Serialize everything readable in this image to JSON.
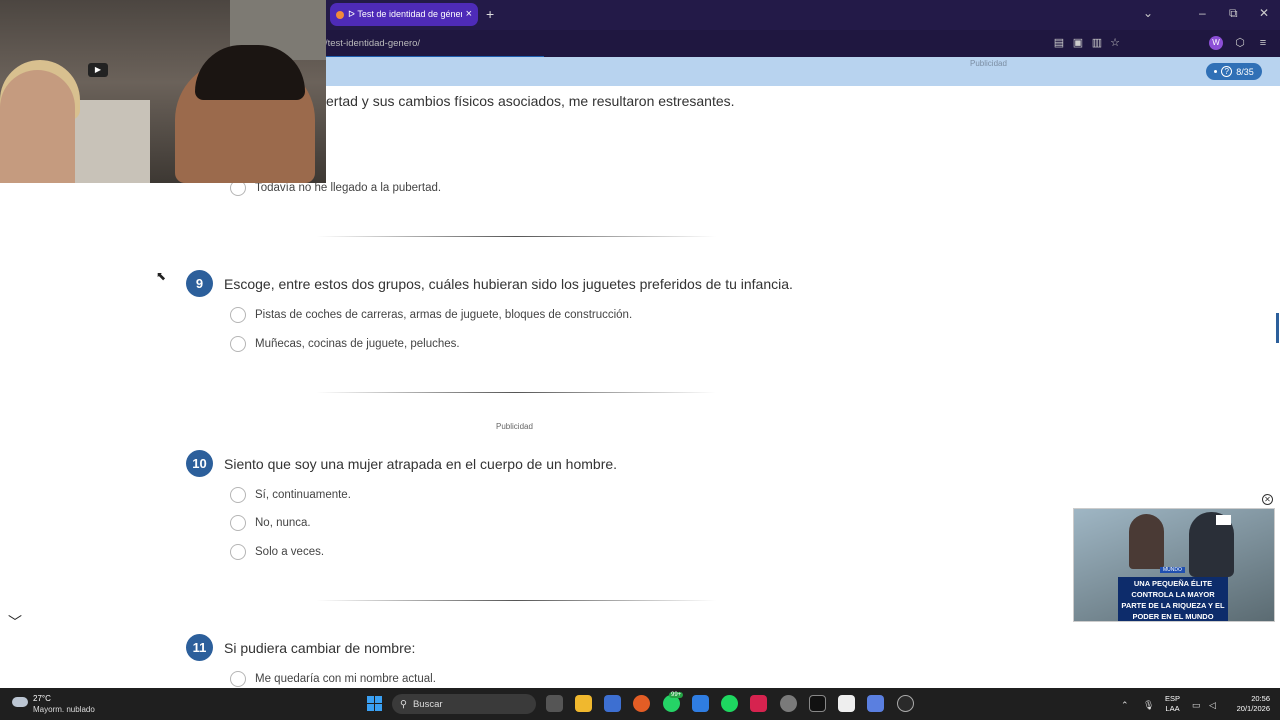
{
  "browser": {
    "tab_title": "ᐅ Test de identidad de género",
    "tab_close": "×",
    "new_tab": "+",
    "url": "/test-identidad-genero/",
    "minimize": "–",
    "restore": "⧉",
    "close": "✕",
    "tabs_menu": "⌄",
    "profile_initial": "W",
    "menu": "≡"
  },
  "page": {
    "ad_label_top": "Publicidad",
    "progress": "8/35",
    "progress_help": "?",
    "previous_question_tail": "ertad y sus cambios físicos asociados, me resultaron estresantes.",
    "previous_last_option": "Todavía no he llegado a la pubertad.",
    "questions": [
      {
        "number": "9",
        "text": "Escoge, entre estos dos grupos, cuáles hubieran sido los juguetes preferidos de tu infancia.",
        "options": [
          "Pistas de coches de carreras, armas de juguete, bloques de construcción.",
          "Muñecas, cocinas de juguete, peluches."
        ]
      },
      {
        "number": "10",
        "text": "Siento que soy una mujer atrapada en el cuerpo de un hombre.",
        "options": [
          "Sí, continuamente.",
          "No, nunca.",
          "Solo a veces."
        ]
      },
      {
        "number": "11",
        "text": "Si pudiera cambiar de nombre:",
        "options": [
          "Me quedaría con mi nombre actual."
        ]
      }
    ],
    "ad_label_mid": "Publicidad",
    "chevron": "﹀"
  },
  "video_ad": {
    "close": "✕",
    "tag": "MUNDO",
    "headline": "UNA PEQUEÑA ÉLITE CONTROLA LA MAYOR PARTE DE LA RIQUEZA Y EL PODER EN EL MUNDO"
  },
  "taskbar": {
    "temperature": "27°C",
    "weather": "Mayorm. nublado",
    "search_label": "Buscar",
    "badge": "99+",
    "lang_top": "ESP",
    "lang_bottom": "LAA",
    "time": "20:56",
    "date": "20/1/2026"
  },
  "colors": {
    "accent": "#2c5f9b",
    "tab_active": "#4e2bb8",
    "browser_bg": "#1b1437",
    "ad_band": "#b8d3ef"
  }
}
